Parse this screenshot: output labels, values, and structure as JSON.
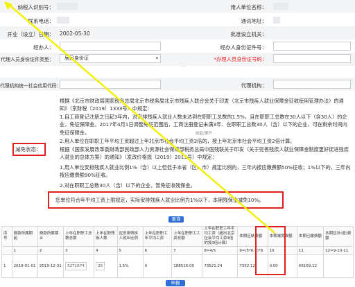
{
  "form": {
    "taxpayer_id_label": "纳税人识别号：",
    "taxpayer_id_value": "",
    "unit_name_label": "用人单位名称：",
    "unit_name_value": "",
    "contact_phone_label": "联系电话：",
    "contact_phone_value": "",
    "address_label": "通讯地址：",
    "address_value": "",
    "established_label": "开业（设立）日期：",
    "established_value": "2002-05-30",
    "approval_org_label": "批准设立机关：",
    "approval_org_value": "",
    "operator_label": "经办人：",
    "operator_value": "",
    "operator_id_label": "经办人身份证件号：",
    "operator_id_value": "",
    "agent_id_type_label": "代理人员身份证件类型：",
    "agent_id_type_value": "居民身份证",
    "agent_id_no_label": "*办理人员身份证号码：",
    "agent_id_no_value": "",
    "agent_credit_label": "代理机构统一社会信用代码：",
    "agent_credit_value": "",
    "agency_label": "代理机构：",
    "agency_value": ""
  },
  "reduction": {
    "label": "减免状态：",
    "para1": "根据《北京市财政局国家税务总局北京市税务局北京市残疾人联合会关于印发〈北京市残疾人就业保障金征收使用管理办法〉的通知》（京财税〔2019〕1333号）中规定：",
    "para2": "1.自工商登记注册之日起3年内，对安排残疾人就业人数未达到在职职工总数的1.5%，且在职职工总数在30人以下（含30人）的企业，免征保障金。2017年4月1日调整免征范围后，工商注册登记未满3年、在职职工总数30人（含）以下的企业，可在剩余时间内免征保障金。",
    "collapse_btn": "收起/展开",
    "para3": "2.用人单位在职职工年平均工资超过上年北京市社会平均工资2倍的，按上年北京市社会平均工资2倍计算。",
    "para4": "根据《国家发展改革委财政部民政部人力资源社会保障部税务总局中国残联关于印发〈关于完善残疾人就业保障金制度更好促进残疾人就业的总体方案〉的通知》（发改价格规〔2019〕2015号）中规定：",
    "para5": "1.用人单位安排残疾人就业比例1%（含）以上但低于本省（区、市）规定比例的，三年内按应缴费额50%征收；1%以下的，三年内按应缴费额90%征收。",
    "para6": "2.对在职职工总数30人（含）以下的企业，暂免征收残保金。",
    "notice": "您单位符合年平均工资上限规定，实际安排残疾人就业比例为1%以下，本期残保金减免10%。"
  },
  "buttons": {
    "query": "查询",
    "submit": "申报"
  },
  "table": {
    "headers": [
      "序号",
      "费款所属期起",
      "费款所属期止",
      "上年在职职工总数总数",
      "上年在职残疾人数",
      "应安排残疾人就业比例",
      "上年在职职工年平均工资",
      "上年在职职工工资总额",
      "上年在职职工年平均工资（超出北京社会平均工资3倍的按3倍计算）",
      "本期应纳费额",
      "本期减免费额",
      "本期已缴费额",
      "本期应补(退)费额"
    ],
    "formula_row": [
      "1",
      "2",
      "3",
      "4",
      "5",
      "6",
      "7",
      "8=4/5",
      "9=(5*6-7)*8",
      "10",
      "11",
      "12=9-10-11"
    ],
    "data_row": [
      "1",
      "2019-01-01",
      "2019-12-31",
      "5271674",
      "26",
      "1.5%",
      "0",
      "188516.00",
      "73521.24",
      "7352.12",
      "0.00",
      "66169.12"
    ]
  },
  "colors": {
    "accent": "#2d6fd4",
    "highlight": "#e02020",
    "annotation_line": "#f2f200"
  }
}
